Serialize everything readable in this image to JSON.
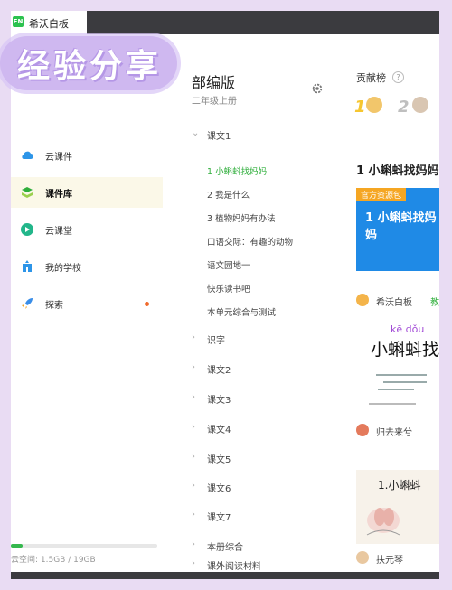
{
  "app": {
    "logo_text": "EN",
    "title": "希沃白板"
  },
  "sticker": {
    "text": "经验分享"
  },
  "sidebar": {
    "items": [
      {
        "label": "云课件",
        "icon": "cloud-icon"
      },
      {
        "label": "课件库",
        "icon": "courseware-library-icon",
        "active": true
      },
      {
        "label": "云课堂",
        "icon": "cloud-classroom-icon"
      },
      {
        "label": "我的学校",
        "icon": "school-icon"
      },
      {
        "label": "探索",
        "icon": "rocket-icon"
      }
    ],
    "storage_label": "云空间:  1.5GB / 19GB",
    "storage_fraction": 0.08
  },
  "catalogue": {
    "book_title": "部编版",
    "grade": "二年级上册",
    "chapters_top": {
      "label": "课文1"
    },
    "lessons": [
      "1 小蝌蚪找妈妈",
      "2 我是什么",
      "3 植物妈妈有办法",
      "口语交际：有趣的动物",
      "语文园地一",
      "快乐读书吧",
      "本单元综合与测试"
    ],
    "chapters": [
      "识字",
      "课文2",
      "课文3",
      "课文4",
      "课文5",
      "课文6",
      "课文7",
      "本册综合",
      "课外阅读材料"
    ]
  },
  "contribution": {
    "title": "贡献榜",
    "help": "?",
    "rank1": "1",
    "rank2": "2"
  },
  "resources": {
    "heading": "1 小蝌蚪找妈妈",
    "card1": {
      "tag": "官方资源包",
      "title": "1 小蝌蚪找妈妈"
    },
    "card1_author": "希沃白板",
    "card1_extra": "教",
    "card2": {
      "pinyin": "kē dǒu",
      "title": "小蝌蚪找"
    },
    "card2_author": "归去来兮",
    "card3": {
      "title": "1.小蝌蚪"
    },
    "card3_author": "扶元琴"
  },
  "colors": {
    "accent": "#2fae3b",
    "brand_blue": "#1f8ae6",
    "tag_orange": "#f5a623"
  }
}
